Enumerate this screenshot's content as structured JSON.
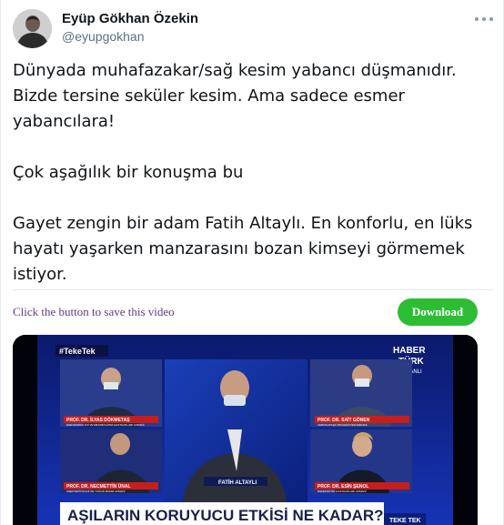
{
  "tweet": {
    "author": {
      "display_name": "Eyüp Gökhan Özekin",
      "handle": "@eyupgokhan"
    },
    "more_icon": "more-horizontal-icon",
    "paragraphs": [
      "Dünyada muhafazakar/sağ kesim yabancı düşmanıdır.",
      "Bizde tersine seküler kesim. Ama sadece esmer",
      "yabancılara!",
      "Çok aşağılık bir konuşma bu",
      "Gayet zengin bir adam Fatih Altaylı. En konforlu, en lüks",
      "hayatı yaşarken manzarasını bozan kimseyi görmemek",
      "istiyor."
    ]
  },
  "save_widget": {
    "prompt": "Click the button to save this video",
    "button_label": "Download",
    "button_color": "#2dbd34",
    "text_color": "#5b3e86"
  },
  "video": {
    "hashtag": "#TekeTek",
    "channel_line1": "HABER",
    "channel_line2": "TÜRK",
    "live_label": "CANLI",
    "guests": [
      {
        "name": "PROF. DR. İLYAS DÖKMETAŞ",
        "title": "ENDOKRİNOLOJİ VE METABOLİZMA HASTALIKLARI UZMANI"
      },
      {
        "name": "FATİH ALTAYLI",
        "title": ""
      },
      {
        "name": "PROF. DR. SAİT GÖNEN",
        "title": "CERRAHPAŞA TIP FAKÜLTESİ DEKANI"
      },
      {
        "name": "PROF. DR. NECMETTİN ÜNAL",
        "title": "ANESTEZİYOLOJİ VE YOĞUN BAKIM UZMANI"
      },
      {
        "name": "PROF. DR. ESİN ŞENOL",
        "title": "ENFEKSİYON HASTALIKLARI UZMANI"
      }
    ],
    "headline": "AŞILARIN KORUYUCU ETKİSİ NE KADAR?",
    "program_tag": "TEKE TEK"
  }
}
